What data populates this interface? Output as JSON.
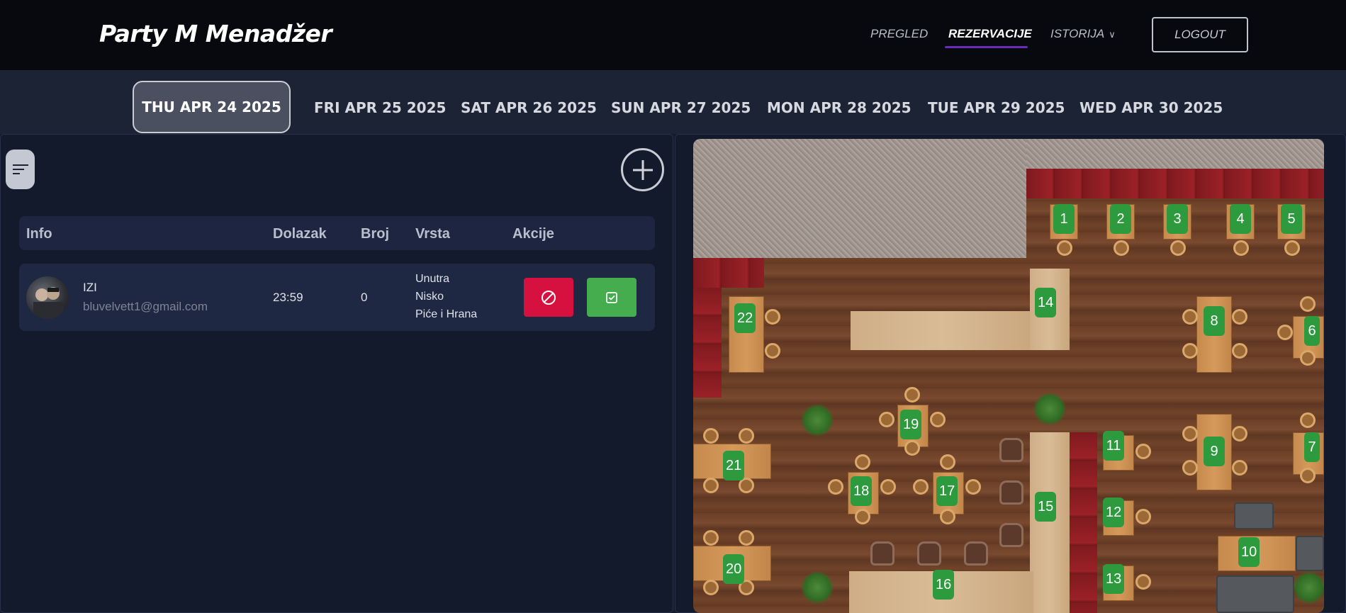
{
  "app": {
    "title": "Party M Menadžer"
  },
  "nav": {
    "items": [
      {
        "label": "PREGLED"
      },
      {
        "label": "REZERVACIJE"
      },
      {
        "label": "ISTORIJA"
      }
    ],
    "logout_label": "LOGOUT"
  },
  "dates": {
    "tabs": [
      {
        "label": "THU APR 24 2025"
      },
      {
        "label": "FRI APR 25 2025"
      },
      {
        "label": "SAT APR 26 2025"
      },
      {
        "label": "SUN APR 27 2025"
      },
      {
        "label": "MON APR 28 2025"
      },
      {
        "label": "TUE APR 29 2025"
      },
      {
        "label": "WED APR 30 2025"
      }
    ],
    "selected": "THU APR 24 2025"
  },
  "reservations": {
    "columns": [
      "Info",
      "Dolazak",
      "Broj",
      "Vrsta",
      "Akcije"
    ],
    "rows": [
      {
        "name": "IZI",
        "email": "bluvelvett1@gmail.com",
        "arrival": "23:59",
        "count": "0",
        "type_lines": [
          "Unutra",
          "Nisko",
          "Piće i Hrana"
        ]
      }
    ]
  },
  "floor_plan": {
    "tables": [
      "1",
      "2",
      "3",
      "4",
      "5",
      "6",
      "7",
      "8",
      "9",
      "10",
      "11",
      "12",
      "13",
      "14",
      "15",
      "16",
      "17",
      "18",
      "19",
      "20",
      "21",
      "22"
    ]
  },
  "colors": {
    "accent": "#6a2bb8",
    "cancel": "#d6103f",
    "confirm": "#46ad4f",
    "table_badge": "#2e9a3e"
  },
  "icons": {
    "filter": "filter-lines-icon",
    "add": "plus-circle-icon",
    "cancel": "ban-icon",
    "confirm": "check-square-icon",
    "dropdown": "chevron-down-icon"
  }
}
